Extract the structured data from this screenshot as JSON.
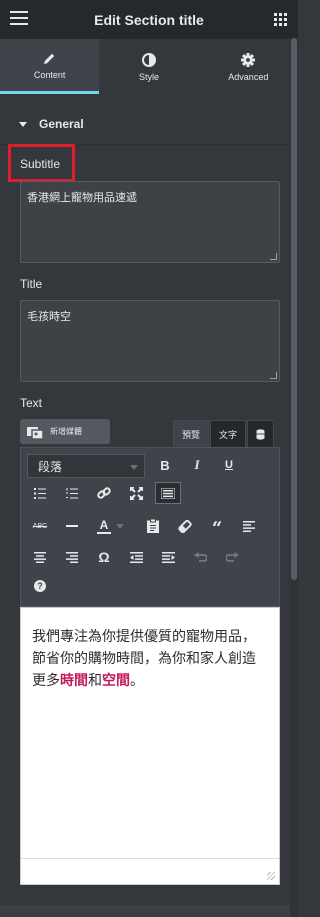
{
  "header": {
    "title": "Edit Section title",
    "menu_icon": "hamburger-icon",
    "apps_icon": "grid-icon"
  },
  "tabs": [
    {
      "label": "Content",
      "icon": "pencil-icon",
      "active": true
    },
    {
      "label": "Style",
      "icon": "contrast-icon",
      "active": false
    },
    {
      "label": "Advanced",
      "icon": "gear-icon",
      "active": false
    }
  ],
  "section": {
    "title": "General",
    "expanded": true
  },
  "fields": {
    "subtitle": {
      "label": "Subtitle",
      "value": "香港網上寵物用品速遞"
    },
    "title": {
      "label": "Title",
      "value": "毛孩時空"
    },
    "text": {
      "label": "Text"
    }
  },
  "editor_toolbar": {
    "add_media_label": "新增媒體",
    "mode_tabs": [
      "預覽",
      "文字"
    ],
    "active_mode": "預覽",
    "format_select_value": "段落",
    "buttons": {
      "bold": "B",
      "italic": "I",
      "underline": "U",
      "strikethrough": "ABC",
      "text_color": "A",
      "special_char": "Ω",
      "help": "?"
    }
  },
  "editor_content": {
    "text_before": "我們專注為你提供優質的寵物用品，節省你的購物時間，為你和家人創造更多",
    "highlight_1": "時間",
    "connector": "和",
    "highlight_2": "空間",
    "text_after": "。",
    "highlight_color": "#c2185b"
  },
  "colors": {
    "accent": "#71d7f7",
    "highlight_border": "#e11d2b",
    "panel_bg": "#34383c",
    "header_bg": "#26292c"
  }
}
